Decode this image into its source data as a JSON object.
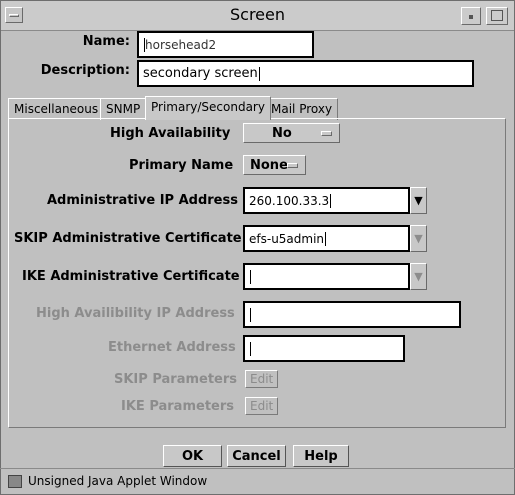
{
  "window": {
    "title": "Screen"
  },
  "form": {
    "name_label": "Name:",
    "name_value": "horsehead2",
    "description_label": "Description:",
    "description_value": "secondary screen"
  },
  "tabs": [
    {
      "label": "Miscellaneous"
    },
    {
      "label": "SNMP"
    },
    {
      "label": "Primary/Secondary"
    },
    {
      "label": "Mail Proxy"
    }
  ],
  "panel": {
    "high_availability_label": "High Availability",
    "high_availability_value": "No",
    "primary_name_label": "Primary Name",
    "primary_name_value": "None",
    "admin_ip_label": "Administrative IP Address",
    "admin_ip_value": "260.100.33.3",
    "skip_admin_cert_label": "SKIP Administrative Certificate",
    "skip_admin_cert_value": "efs-u5admin",
    "ike_admin_cert_label": "IKE Administrative Certificate",
    "ike_admin_cert_value": "",
    "ha_ip_label": "High Availibility IP Address",
    "ha_ip_value": "",
    "ethernet_label": "Ethernet Address",
    "ethernet_value": "",
    "skip_params_label": "SKIP Parameters",
    "skip_params_button": "Edit",
    "ike_params_label": "IKE Parameters",
    "ike_params_button": "Edit"
  },
  "buttons": {
    "ok": "OK",
    "cancel": "Cancel",
    "help": "Help"
  },
  "status": {
    "text": "Unsigned Java Applet Window"
  }
}
